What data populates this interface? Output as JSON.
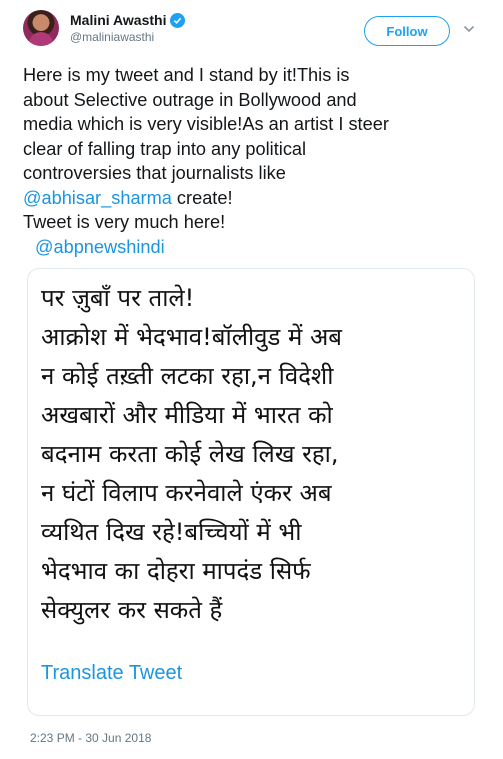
{
  "header": {
    "display_name": "Malini Awasthi",
    "handle": "@maliniawasthi",
    "follow_label": "Follow"
  },
  "tweet": {
    "lines": [
      "Here is my tweet and I stand by it!This is",
      "about Selective outrage in Bollywood and",
      "media which is very visible!As an artist I steer",
      "clear of falling trap into any political",
      "controversies that journalists like"
    ],
    "mention1": "@abhisar_sharma",
    "after_mention1": " create!",
    "line_last": "Tweet is very much here!",
    "mention2": "@abpnewshindi"
  },
  "card": {
    "hindi_lines": [
      "पर ज़ुबाँ पर ताले!",
      "आक्रोश में भेदभाव!बॉलीवुड में अब",
      "न कोई तख़्ती लटका रहा,न विदेशी",
      "अखबारों और मीडिया में भारत को",
      "बदनाम करता कोई लेख लिख रहा,",
      "न घंटों विलाप करनेवाले एंकर अब",
      "व्यथित दिख रहे!बच्चियों में भी",
      "भेदभाव का दोहरा मापदंड सिर्फ",
      "सेक्युलर कर सकते हैं"
    ],
    "translate_label": "Translate Tweet"
  },
  "timestamp": "2:23 PM - 30 Jun 2018",
  "colors": {
    "accent": "#1da1f2",
    "link": "#1b95e0",
    "muted": "#657786"
  }
}
